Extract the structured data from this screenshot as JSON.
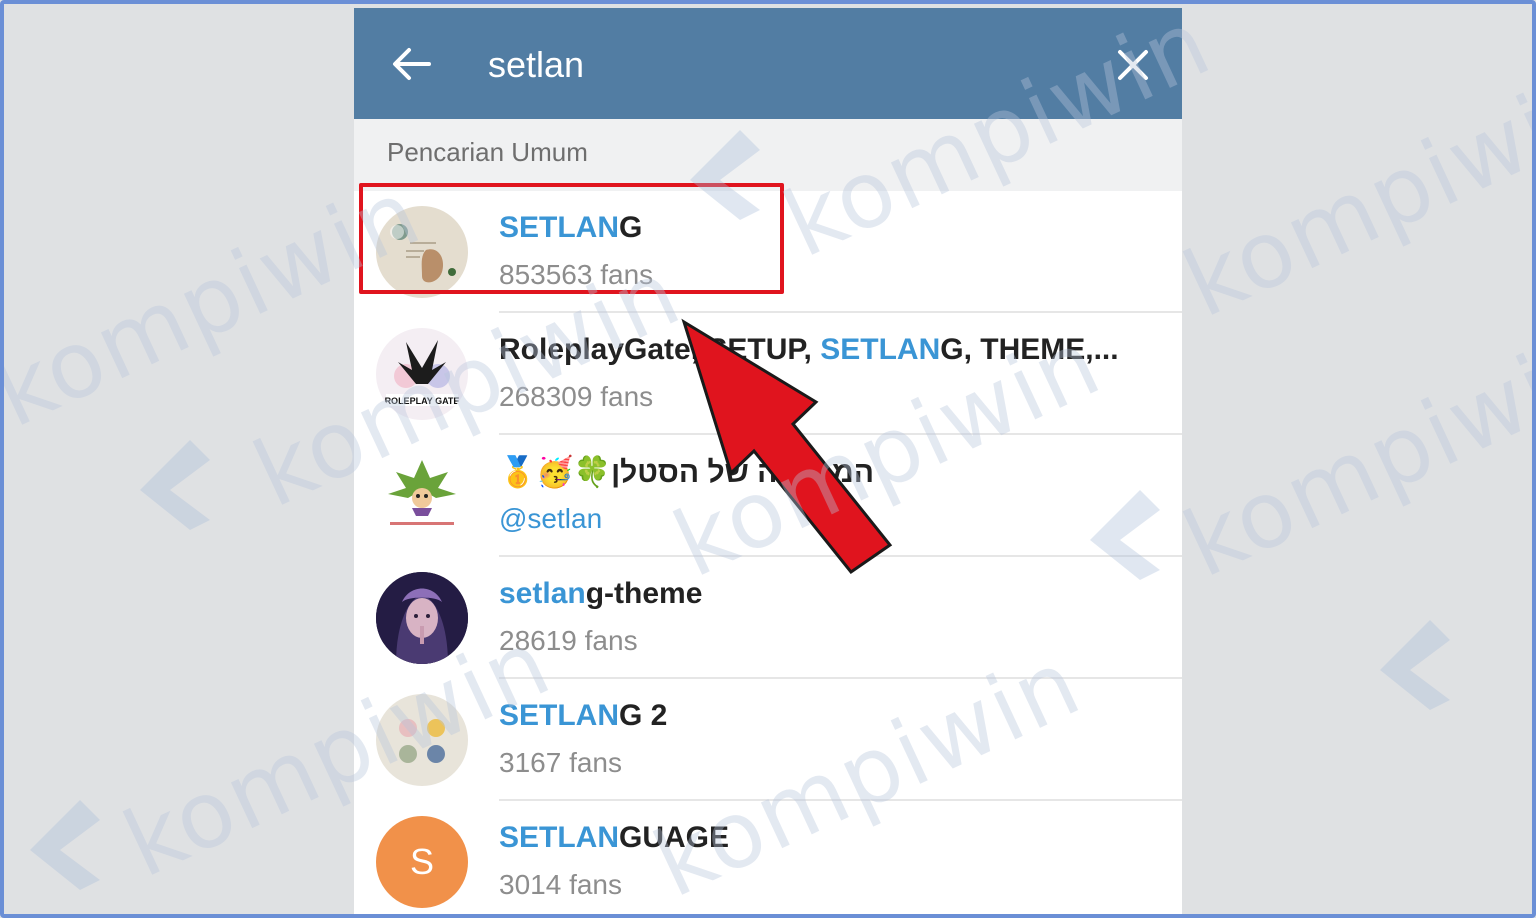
{
  "search": {
    "query": "setlan",
    "back_icon": "arrow-left-icon",
    "clear_icon": "close-icon"
  },
  "section": {
    "title": "Pencarian Umum"
  },
  "results": [
    {
      "title_highlight": "SETLAN",
      "title_rest": "G",
      "subtitle": "853563 fans",
      "avatar": "setlang-avatar"
    },
    {
      "title_pre": "RoleplayGate, SETUP, ",
      "title_highlight": "SETLAN",
      "title_rest": "G, THEME,...",
      "subtitle": "268309 fans",
      "avatar": "roleplaygate-avatar",
      "avatar_text": "ROLEPLAY GATE"
    },
    {
      "title_emoji": "🥇🥳🍀",
      "title_rest": "הממלכה של הסטלן",
      "subtitle": "@setlan",
      "avatar": "setlan-plant-avatar"
    },
    {
      "title_highlight": "setlan",
      "title_rest": "g-theme",
      "subtitle": "28619 fans",
      "avatar": "portrait-avatar"
    },
    {
      "title_highlight": "SETLAN",
      "title_rest": "G 2",
      "subtitle": "3167 fans",
      "avatar": "faces-avatar"
    },
    {
      "title_highlight": "SETLAN",
      "title_rest": "GUAGE",
      "subtitle": "3014 fans",
      "avatar": "letter-avatar",
      "avatar_letter": "S"
    }
  ],
  "watermark": {
    "text": "kompiwin"
  },
  "colors": {
    "topbar": "#527da3",
    "highlight": "#3a95d5",
    "annotation_red": "#e0141e",
    "frame": "#6b8fd6"
  }
}
